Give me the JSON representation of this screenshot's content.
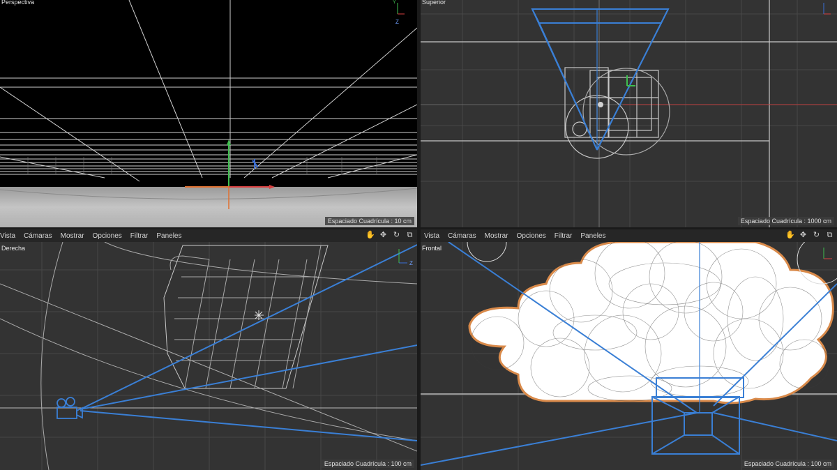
{
  "viewports": {
    "perspective": {
      "label": "Perspectiva",
      "grid_note": "Espaciado Cuadrícula : 10 cm"
    },
    "top": {
      "label": "Superior",
      "grid_note": "Espaciado Cuadrícula : 1000 cm"
    },
    "right": {
      "label": "Derecha",
      "grid_note": "Espaciado Cuadrícula : 100 cm"
    },
    "front": {
      "label": "Frontal",
      "grid_note": "Espaciado Cuadrícula : 100 cm"
    }
  },
  "menus": {
    "left": [
      "Vista",
      "Cámaras",
      "Mostrar",
      "Opciones",
      "Filtrar",
      "Paneles"
    ],
    "right": [
      "Vista",
      "Cámaras",
      "Mostrar",
      "Opciones",
      "Filtrar",
      "Paneles"
    ]
  },
  "view_icons": [
    "move-hand-icon",
    "move-arrows-icon",
    "rotate-icon",
    "maximize-icon"
  ],
  "axes": {
    "y": "Y",
    "z": "Z"
  },
  "colors": {
    "bg_dark": "#333333",
    "bg_black": "#000000",
    "grid": "#4a4a4a",
    "wire": "#d8d8d8",
    "camera_blue": "#3a7fd5",
    "axis_x": "#d94040",
    "axis_y": "#3fbf4f",
    "axis_z": "#3a6fd8"
  }
}
